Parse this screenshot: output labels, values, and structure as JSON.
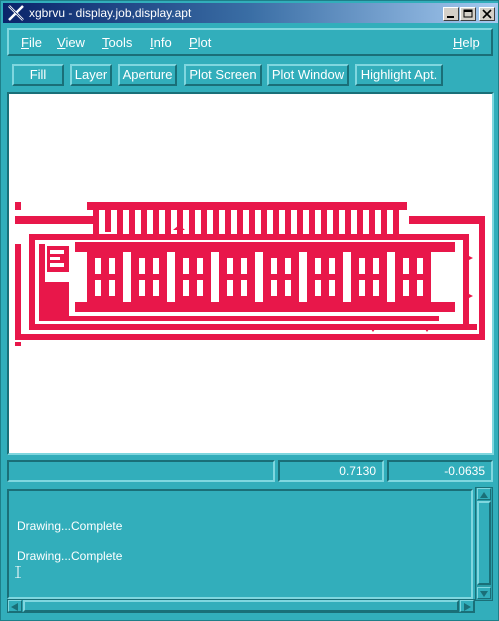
{
  "window": {
    "title": "xgbrvu - display.job,display.apt",
    "app_icon": "x-logo-icon",
    "controls": [
      "minimize-icon",
      "maximize-icon",
      "close-icon"
    ]
  },
  "menubar": {
    "file": "File",
    "view": "View",
    "tools": "Tools",
    "info": "Info",
    "plot": "Plot",
    "help": "Help"
  },
  "toolbar": {
    "fill": "Fill",
    "layer": "Layer",
    "aperture": "Aperture",
    "plot_screen": "Plot Screen",
    "plot_window": "Plot Window",
    "highlight_apt": "Highlight Apt."
  },
  "canvas": {
    "background": "#ffffff",
    "trace_color": "#e8174a"
  },
  "status": {
    "field1": "",
    "x_coord": "0.7130",
    "y_coord": "-0.0635"
  },
  "console": {
    "line1": "Drawing...Complete",
    "line2": "Drawing...Complete"
  },
  "colors": {
    "panel": "#32aebb",
    "title_start": "#0a246a",
    "text": "#ffffff"
  }
}
